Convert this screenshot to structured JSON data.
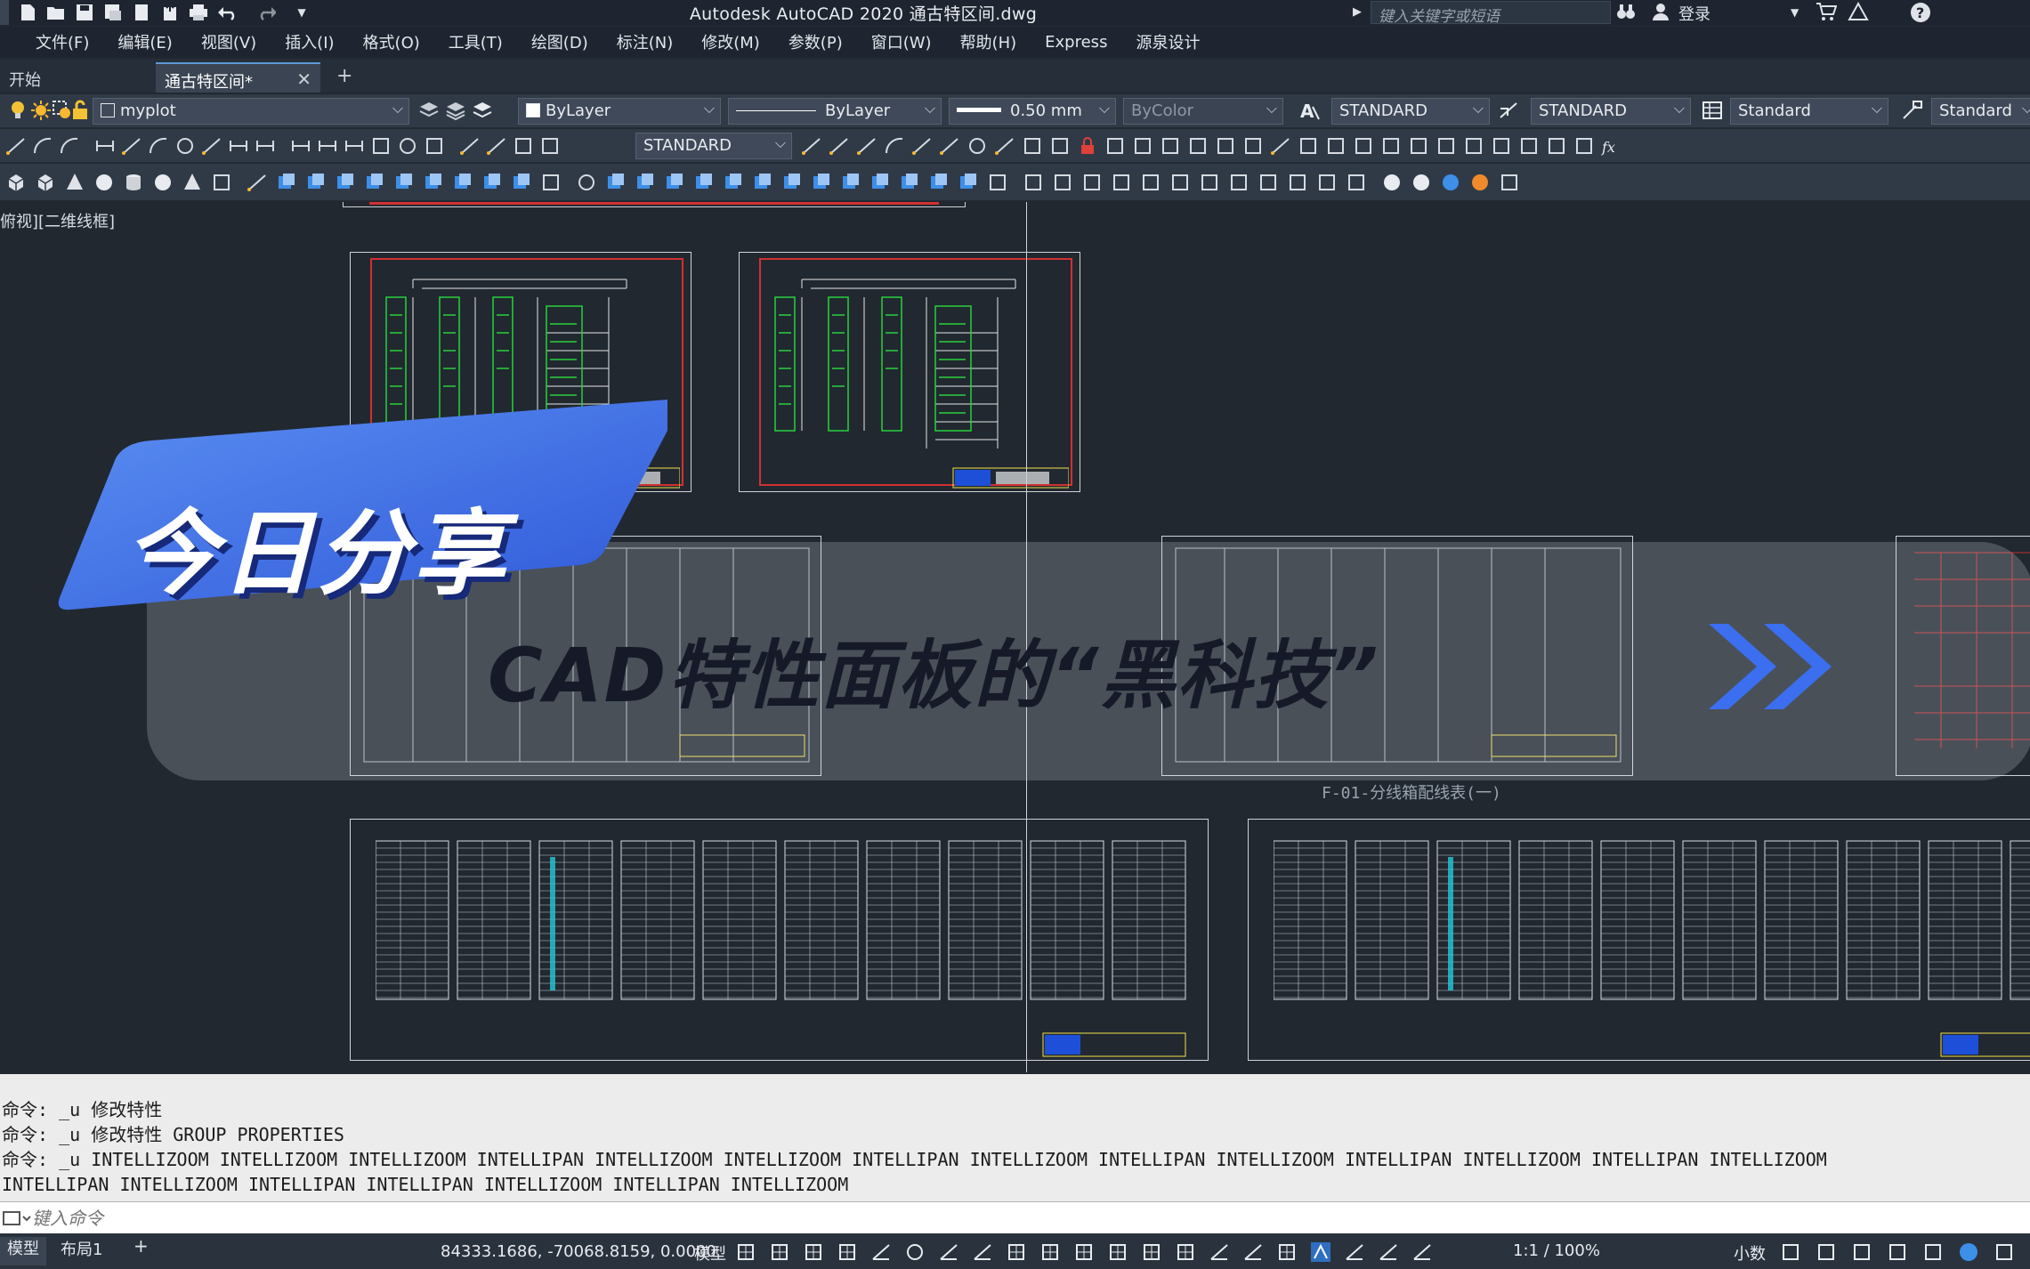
{
  "title_bar": {
    "app_title": "Autodesk AutoCAD 2020    通古特区间.dwg",
    "search_placeholder": "键入关键字或短语",
    "login_label": "登录"
  },
  "menu": [
    "文件(F)",
    "编辑(E)",
    "视图(V)",
    "插入(I)",
    "格式(O)",
    "工具(T)",
    "绘图(D)",
    "标注(N)",
    "修改(M)",
    "参数(P)",
    "窗口(W)",
    "帮助(H)",
    "Express",
    "源泉设计"
  ],
  "tabs": {
    "start": "开始",
    "file": "通古特区间*",
    "add": "+"
  },
  "toolbar_props": {
    "layer": "myplot",
    "color": "ByLayer",
    "linetype": "ByLayer",
    "lineweight": "0.50 mm",
    "plotstyle": "ByColor",
    "text_style": "STANDARD",
    "dim_style": "STANDARD",
    "table_style": "Standard",
    "mleader_style": "Standard",
    "dim_style_2": "STANDARD"
  },
  "canvas": {
    "viewport_label": "俯视][二维线框]",
    "sheet_caption": "F-01-分线箱配线表(一)"
  },
  "overlay": {
    "badge": "今日分享",
    "headline": "CAD特性面板的“黑科技”",
    "badge_color": "#3f6fe3",
    "chevron_color": "#3b6ff0"
  },
  "command_history": [
    "命令: _u 修改特性",
    "命令: _u 修改特性 GROUP PROPERTIES",
    "命令: _u INTELLIZOOM INTELLIZOOM INTELLIZOOM INTELLIPAN INTELLIZOOM INTELLIZOOM INTELLIPAN INTELLIZOOM INTELLIPAN INTELLIZOOM INTELLIPAN INTELLIZOOM INTELLIPAN INTELLIZOOM",
    "INTELLIPAN INTELLIZOOM INTELLIPAN INTELLIPAN INTELLIZOOM INTELLIPAN INTELLIZOOM"
  ],
  "command_input_placeholder": "键入命令",
  "status_bar": {
    "model_tab": "模型",
    "layout_tab": "布局1",
    "coords": "84333.1686, -70068.8159, 0.0000",
    "model_label": "模型",
    "scale": "1:1 / 100%",
    "units": "小数"
  }
}
